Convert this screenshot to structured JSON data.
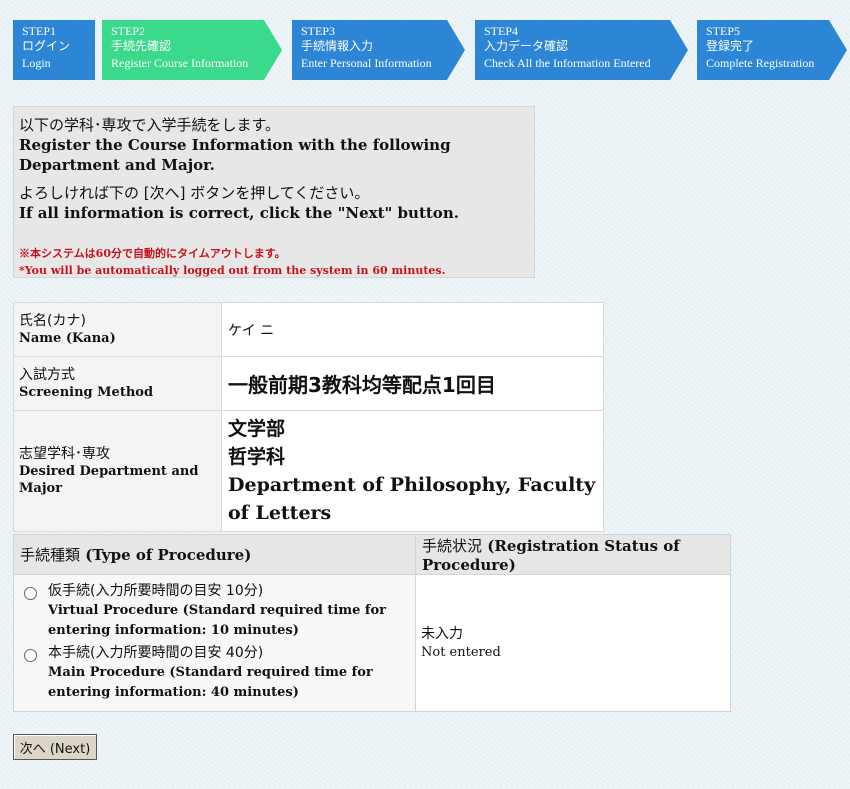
{
  "steps": [
    {
      "step": "STEP1",
      "ja": "ログイン",
      "en": "Login"
    },
    {
      "step": "STEP2",
      "ja": "手続先確認",
      "en": "Register Course Information"
    },
    {
      "step": "STEP3",
      "ja": "手続情報入力",
      "en": "Enter Personal Information"
    },
    {
      "step": "STEP4",
      "ja": "入力データ確認",
      "en": "Check All the Information Entered"
    },
    {
      "step": "STEP5",
      "ja": "登録完了",
      "en": "Complete Registration"
    }
  ],
  "notice": {
    "line1_ja": "以下の学科･専攻で入学手続をします。",
    "line1_en": "Register the Course Information with the following Department and Major.",
    "line2_ja": "よろしければ下の [次へ] ボタンを押してください。",
    "line2_en": "If all information is correct, click the \"Next\" button.",
    "warn_ja": "※本システムは60分で自動的にタイムアウトします。",
    "warn_en": "*You will be automatically logged out from the system in 60 minutes."
  },
  "info": {
    "name_label_ja": "氏名(カナ)",
    "name_label_en": "Name (Kana)",
    "name_value": "ケイ ニ",
    "method_label_ja": "入試方式",
    "method_label_en": "Screening Method",
    "method_value": "一般前期3教科均等配点1回目",
    "dept_label_ja": "志望学科･専攻",
    "dept_label_en": "Desired Department and Major",
    "dept_faculty": "文学部",
    "dept_dept": "哲学科",
    "dept_en": "Department of Philosophy, Faculty of Letters"
  },
  "procedure": {
    "header_type_ja": "手続種類",
    "header_type_en": "(Type of Procedure)",
    "header_status_ja": "手続状況",
    "header_status_en": "(Registration Status of Procedure)",
    "options": [
      {
        "ja": "仮手続(入力所要時間の目安 10分)",
        "en": "Virtual Procedure (Standard required time for entering information: 10 minutes)"
      },
      {
        "ja": "本手続(入力所要時間の目安 40分)",
        "en": "Main Procedure (Standard required time for entering information: 40 minutes)"
      }
    ],
    "status_ja": "未入力",
    "status_en": "Not entered"
  },
  "next_button": "次へ (Next)",
  "colors": {
    "step_active": "#3ad98b",
    "step_inactive": "#2d86d5",
    "warning": "#c8121a"
  }
}
